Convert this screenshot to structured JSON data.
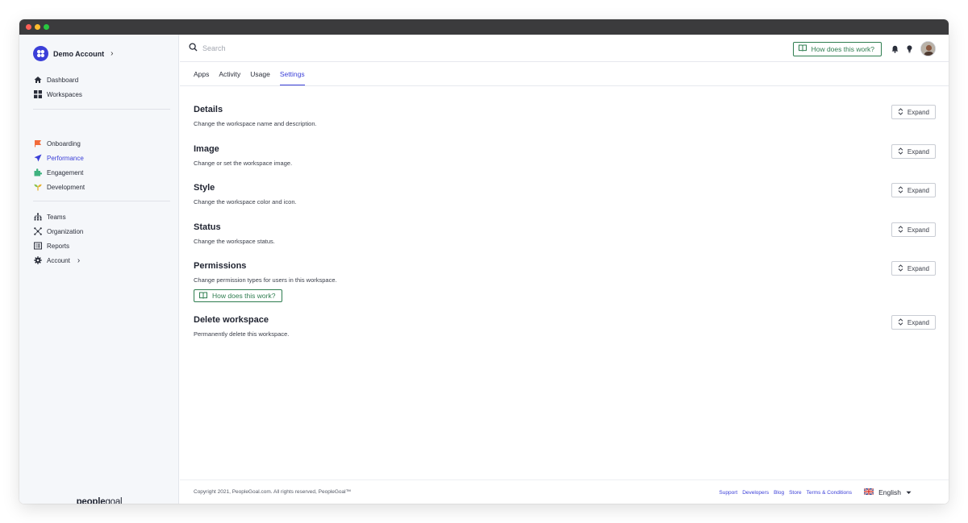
{
  "account": {
    "name": "Demo Account"
  },
  "sidebar": {
    "group1": [
      {
        "label": "Dashboard",
        "icon": "home-icon"
      },
      {
        "label": "Workspaces",
        "icon": "grid-icon"
      }
    ],
    "group2": [
      {
        "label": "Onboarding",
        "icon": "flag-icon"
      },
      {
        "label": "Performance",
        "icon": "paper-plane-icon"
      },
      {
        "label": "Engagement",
        "icon": "puzzle-icon"
      },
      {
        "label": "Development",
        "icon": "sprout-icon"
      }
    ],
    "group3": [
      {
        "label": "Teams",
        "icon": "hierarchy-icon"
      },
      {
        "label": "Organization",
        "icon": "network-icon"
      },
      {
        "label": "Reports",
        "icon": "report-icon"
      },
      {
        "label": "Account",
        "icon": "gear-icon"
      }
    ]
  },
  "brand": {
    "bold": "people",
    "regular": "goal"
  },
  "search": {
    "placeholder": "Search"
  },
  "header": {
    "how_label": "How does this work?"
  },
  "tabs": [
    {
      "label": "Apps"
    },
    {
      "label": "Activity"
    },
    {
      "label": "Usage"
    },
    {
      "label": "Settings",
      "active": true
    }
  ],
  "sections": [
    {
      "title": "Details",
      "description": "Change the workspace name and description.",
      "button": "Expand"
    },
    {
      "title": "Image",
      "description": "Change or set the workspace image.",
      "button": "Expand"
    },
    {
      "title": "Style",
      "description": "Change the workspace color and icon.",
      "button": "Expand"
    },
    {
      "title": "Status",
      "description": "Change the workspace status.",
      "button": "Expand"
    },
    {
      "title": "Permissions",
      "description": "Change permission types for users in this workspace.",
      "button": "Expand",
      "help": "How does this work?"
    },
    {
      "title": "Delete workspace",
      "description": "Permanently delete this workspace.",
      "button": "Expand"
    }
  ],
  "footer": {
    "copyright": "Copyright 2021, PeopleGoal.com. All rights reserved, PeopleGoal™",
    "links": [
      "Support",
      "Developers",
      "Blog",
      "Store",
      "Terms & Conditions"
    ],
    "language": "English"
  },
  "colors": {
    "accent": "#3b3fd8",
    "help_green": "#2e7d4f",
    "onboarding": "#f26b3a",
    "engagement": "#3fb27f",
    "development": "#e6b02e"
  }
}
